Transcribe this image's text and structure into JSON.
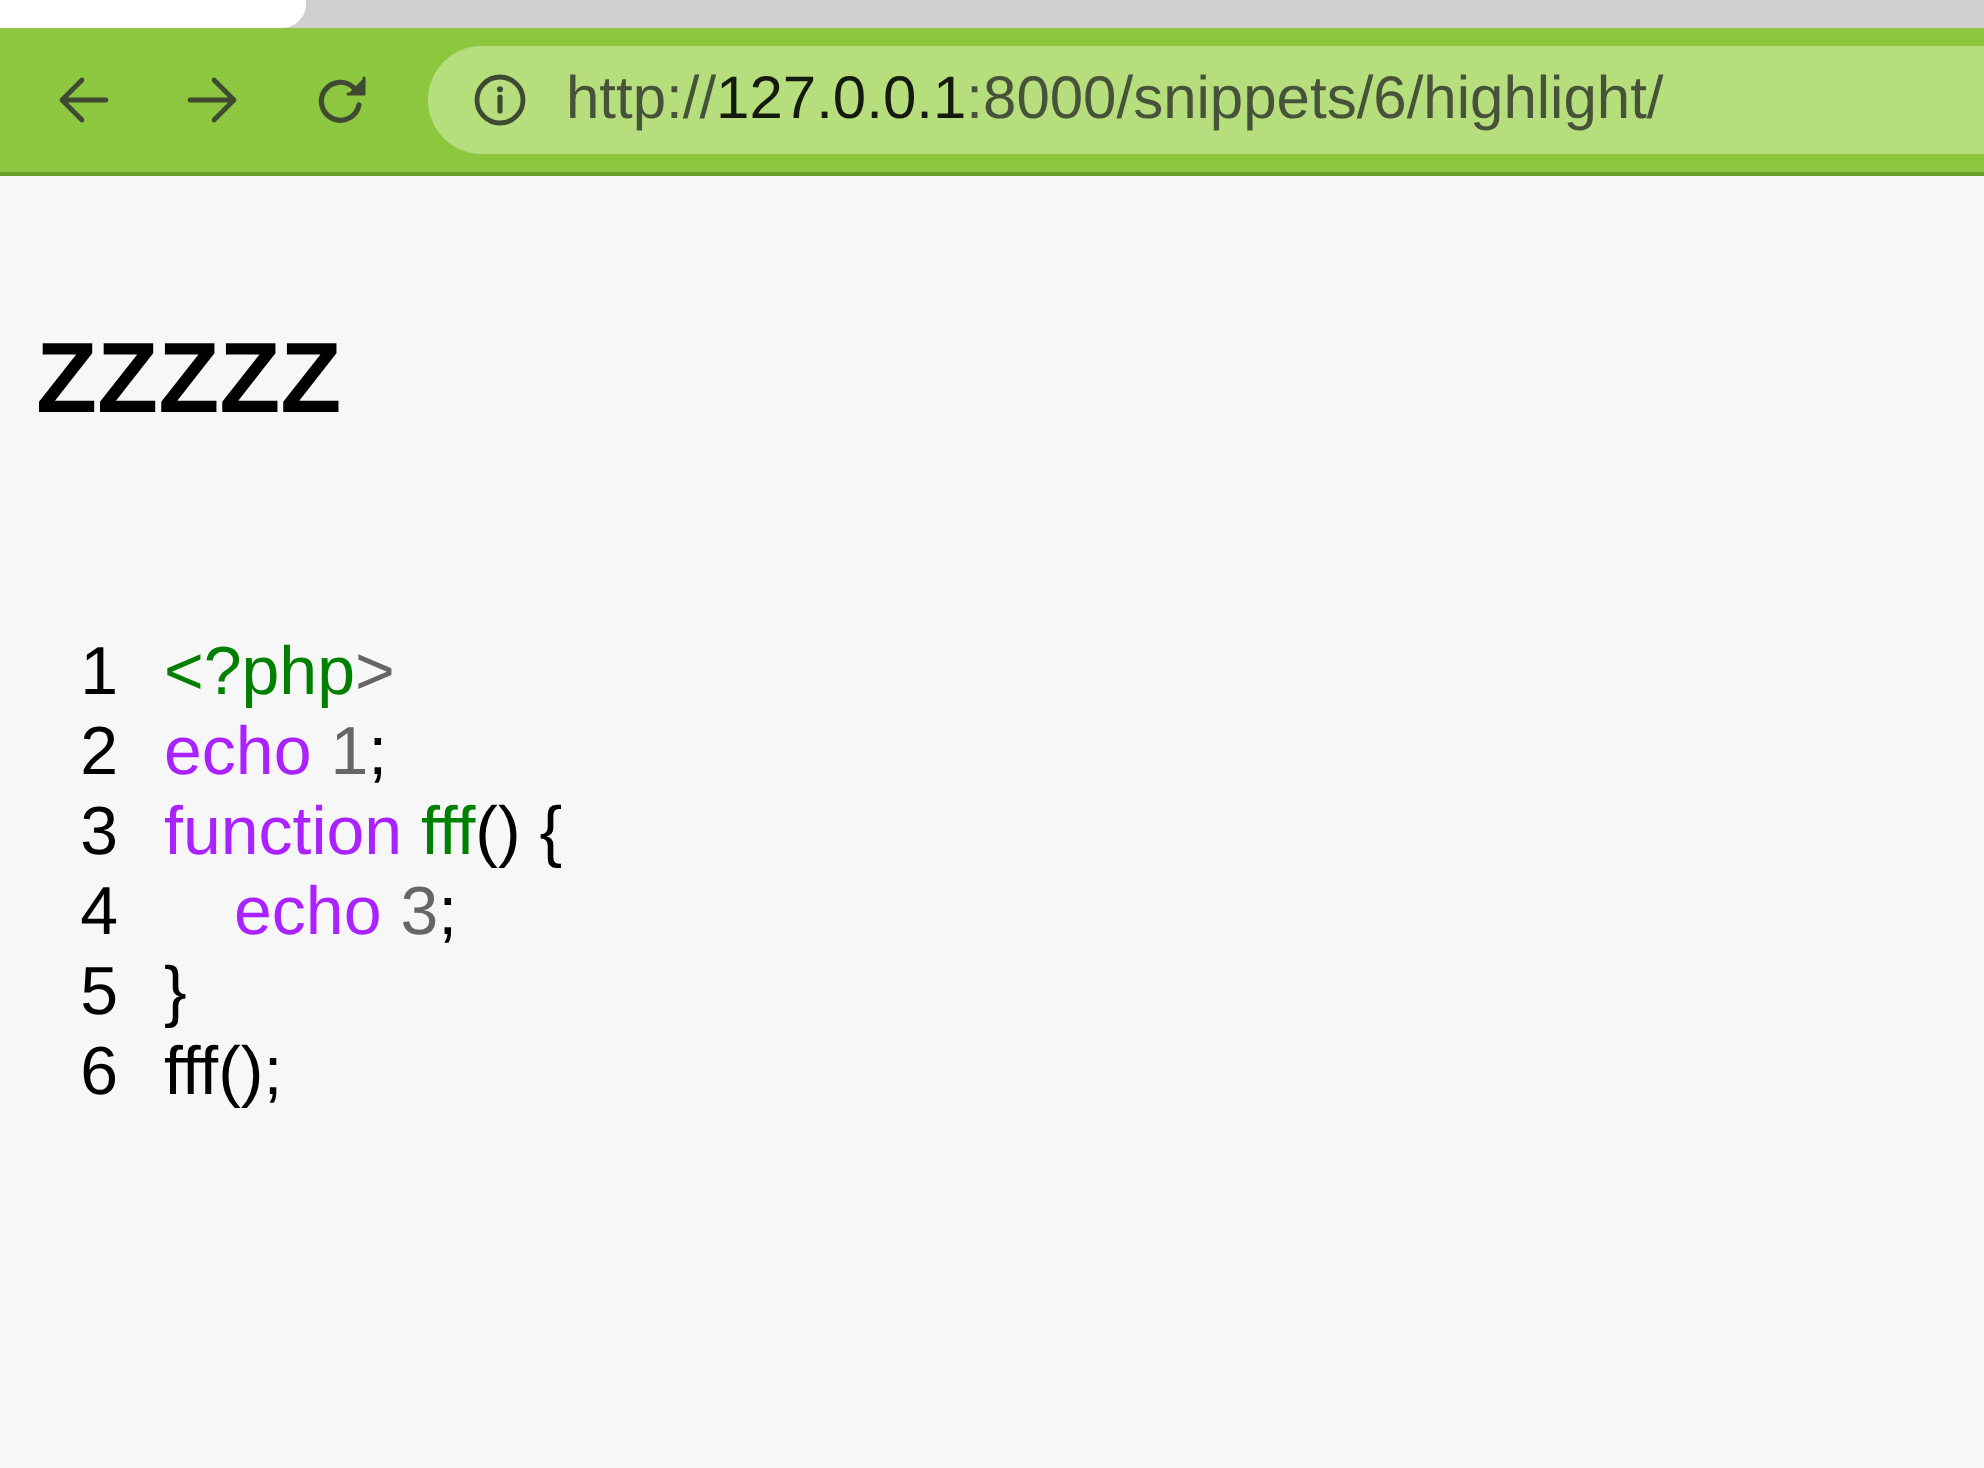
{
  "address_bar": {
    "url_parts": [
      {
        "kind": "scheme",
        "text": "http://"
      },
      {
        "kind": "host",
        "text": "127.0.0.1"
      },
      {
        "kind": "path",
        "text": ":8000/snippets/6/highlight/"
      }
    ]
  },
  "page": {
    "title": "ZZZZZ",
    "code_lines": [
      {
        "number": "1",
        "tokens": [
          {
            "kind": "tag",
            "text": "<?php"
          },
          {
            "kind": "operator",
            "text": ">"
          }
        ]
      },
      {
        "number": "2",
        "tokens": [
          {
            "kind": "keyword",
            "text": "echo "
          },
          {
            "kind": "number",
            "text": "1"
          },
          {
            "kind": "punctuation",
            "text": ";"
          }
        ]
      },
      {
        "number": "3",
        "tokens": [
          {
            "kind": "keyword",
            "text": "function "
          },
          {
            "kind": "function",
            "text": "fff"
          },
          {
            "kind": "punctuation",
            "text": "() {"
          }
        ],
        "children": [
          {
            "number": "4",
            "tokens": [
              {
                "kind": "keyword",
                "text": "echo "
              },
              {
                "kind": "number",
                "text": "3"
              },
              {
                "kind": "punctuation",
                "text": ";"
              }
            ]
          }
        ]
      },
      {
        "number": "5",
        "tokens": [
          {
            "kind": "punctuation",
            "text": "}"
          }
        ]
      },
      {
        "number": "6",
        "tokens": [
          {
            "kind": "text",
            "text": "fff();"
          }
        ]
      }
    ]
  }
}
